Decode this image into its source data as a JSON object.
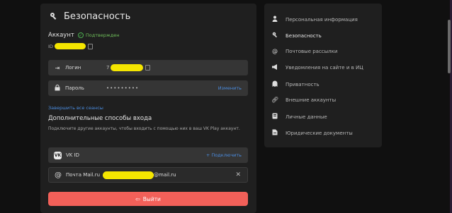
{
  "header": {
    "title": "Безопасность",
    "icon": "key-icon"
  },
  "account": {
    "label": "Аккаунт",
    "status": "Подтвержден",
    "id_prefix": "ID"
  },
  "login": {
    "label": "Логин",
    "value_prefix": "7"
  },
  "password": {
    "label": "Пароль",
    "value": "•••••••••",
    "action": "Изменить"
  },
  "end_sessions": "Завершить все сеансы",
  "extra_login": {
    "title": "Дополнительные способы входа",
    "description": "Подключите другие аккаунты, чтобы входить с помощью них в ваш VK Play аккаунт."
  },
  "vkid": {
    "logo": "VK",
    "label": "VK ID",
    "action": "+ Подключить"
  },
  "mail": {
    "label": "Почта Mail.ru",
    "value_suffix": "@mail.ru"
  },
  "logout": {
    "label": "Выйти"
  },
  "sidebar": {
    "items": [
      {
        "label": "Персональная информация",
        "icon": "person-icon",
        "active": false
      },
      {
        "label": "Безопасность",
        "icon": "key-icon",
        "active": true
      },
      {
        "label": "Почтовые рассылки",
        "icon": "at-icon",
        "active": false
      },
      {
        "label": "Уведомления на сайте и в ИЦ",
        "icon": "megaphone-icon",
        "active": false
      },
      {
        "label": "Приватность",
        "icon": "ghost-icon",
        "active": false
      },
      {
        "label": "Внешние аккаунты",
        "icon": "link-icon",
        "active": false
      },
      {
        "label": "Личные данные",
        "icon": "id-card-icon",
        "active": false
      },
      {
        "label": "Юридические документы",
        "icon": "document-icon",
        "active": false
      }
    ]
  },
  "colors": {
    "accent_link": "#4b8de0",
    "verified": "#6fbf5a",
    "logout": "#f26059",
    "redaction": "#f5e600"
  }
}
